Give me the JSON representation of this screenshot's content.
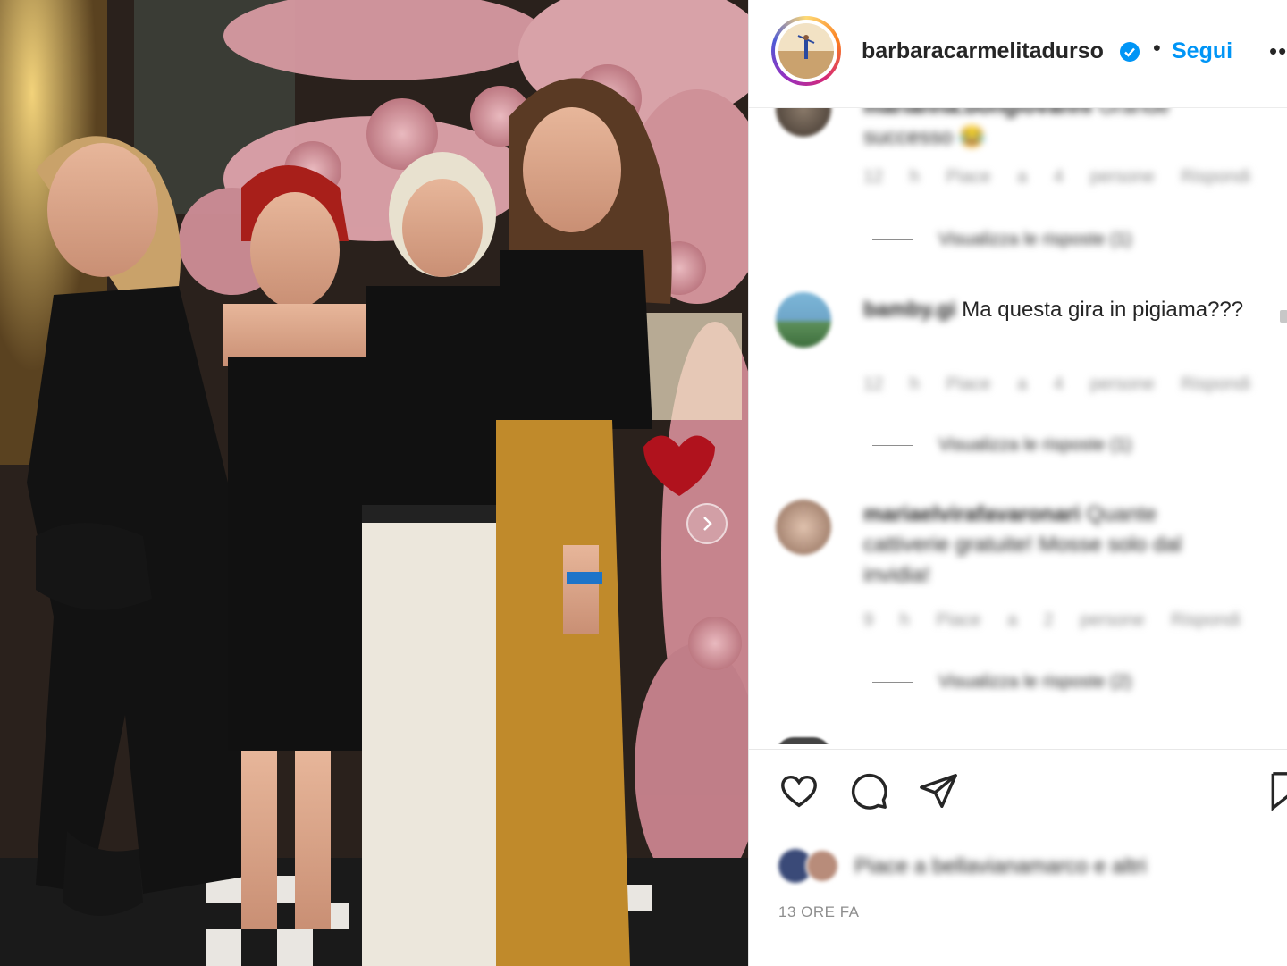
{
  "post": {
    "username": "barbaracarmelitadurso",
    "separator": "•",
    "follow_label": "Segui",
    "more_label": "•••",
    "timestamp": "13 ORE FA"
  },
  "comments": [
    {
      "username": "marianna.bongiovanni",
      "text": "Grande successo 😂",
      "time": "12 h",
      "likes": "Piace a 4 persone",
      "reply": "Rispondi",
      "view_replies": "Visualizza le risposte (1)"
    },
    {
      "username": "bamby.gi",
      "text": "Ma questa gira in pigiama???",
      "time": "12 h",
      "likes": "Piace a 4 persone",
      "reply": "Rispondi",
      "view_replies": "Visualizza le risposte (1)"
    },
    {
      "username": "mariaelvirafavaronari",
      "text": "Quante cattiverie gratuite! Mosse solo dal invidia!",
      "time": "9 h",
      "likes": "Piace a 2 persone",
      "reply": "Rispondi",
      "view_replies": "Visualizza le risposte (2)"
    }
  ],
  "likes_text": "Piace a bellavianamarco e altri",
  "icons": {
    "like": "heart-icon",
    "comment": "comment-icon",
    "share": "send-icon",
    "save": "bookmark-icon",
    "verified": "verified-badge-icon",
    "next": "chevron-right-icon"
  },
  "colors": {
    "link": "#0095f6",
    "text": "#262626",
    "muted": "#8e8e8e",
    "verified": "#0095f6"
  }
}
